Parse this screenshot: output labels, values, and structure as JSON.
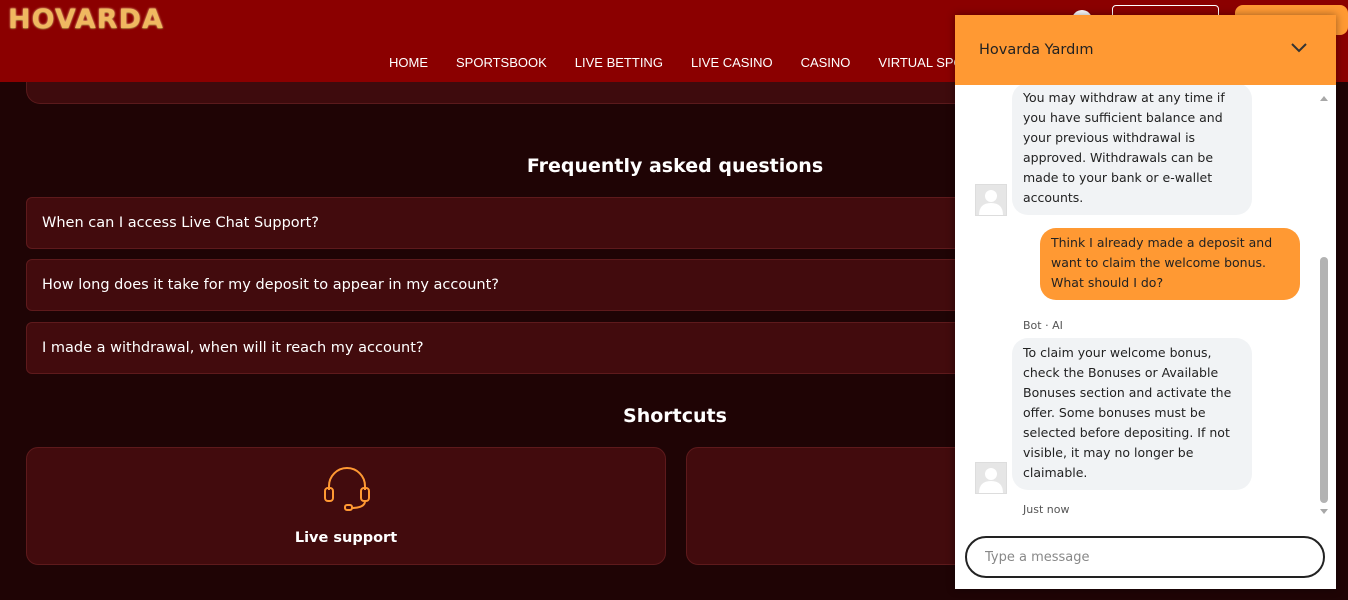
{
  "header": {
    "logo": "HOVARDA",
    "nav": [
      "HOME",
      "SPORTSBOOK",
      "LIVE BETTING",
      "LIVE CASINO",
      "CASINO",
      "VIRTUAL SPORT"
    ]
  },
  "faq": {
    "title": "Frequently asked questions",
    "items": [
      "When can I access Live Chat Support?",
      "How long does it take for my deposit to appear in my account?",
      "I made a withdrawal, when will it reach my account?"
    ]
  },
  "shortcuts": {
    "title": "Shortcuts",
    "cards": [
      {
        "label": "Live support",
        "icon": "headset-icon"
      },
      {
        "label": ""
      }
    ]
  },
  "chat": {
    "title": "Hovarda Yardım",
    "messages": [
      {
        "from": "bot",
        "text": "You may withdraw at any time if you have sufficient balance and your previous withdrawal is approved. Withdrawals can be made to your bank or e-wallet accounts."
      },
      {
        "from": "user",
        "text": "Think I already made a deposit and want to claim the welcome bonus. What should I do?"
      },
      {
        "from": "bot",
        "sender": "Bot · AI",
        "text": "To claim your welcome bonus, check the Bonuses or Available Bonuses section and activate the offer. Some bonuses must be selected before depositing. If not visible, it may no longer be claimable.",
        "time": "Just now"
      }
    ],
    "input_placeholder": "Type a message"
  },
  "colors": {
    "header_bg": "#8b0000",
    "page_bg": "#1f0405",
    "card_bg": "#420b0d",
    "accent": "#ff9933"
  }
}
